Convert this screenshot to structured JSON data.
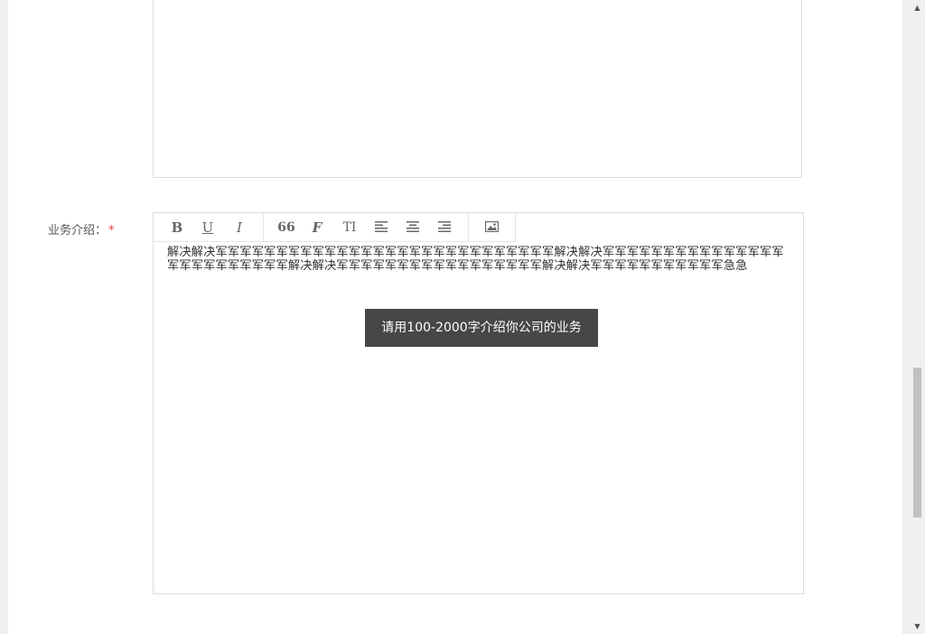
{
  "form": {
    "label": "业务介绍：",
    "required_mark": "*"
  },
  "toolbar": {
    "bold": "B",
    "underline": "U",
    "italic": "I",
    "quote": "66",
    "font": "F",
    "text_size": "TI"
  },
  "editor": {
    "content": "解决解决军军军军军军军军军军军军军军军军军军军军军军军军军军军军解决解决军军军军军军军军军军军军军军军军军军军军军军军军军解决解决军军军军军军军军军军军军军军军军军解决解决军军军军军军军军军军军急急"
  },
  "toast": {
    "message": "请用100-2000字介绍你公司的业务"
  },
  "scrollbar": {
    "up": "▲",
    "down": "▼"
  }
}
